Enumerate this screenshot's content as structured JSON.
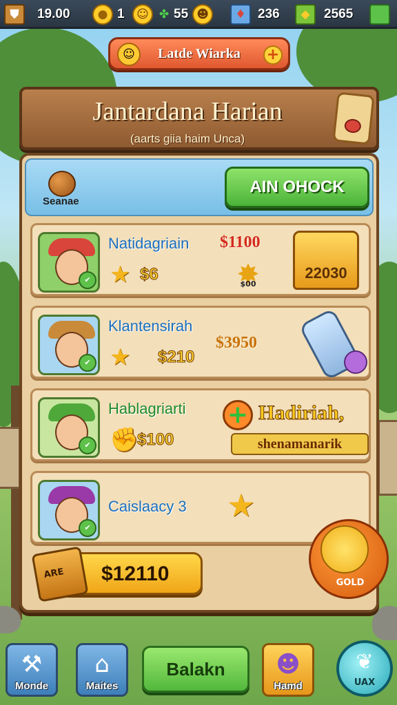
{
  "topbar": {
    "items": [
      {
        "icon": "shield-icon",
        "value": "19.00"
      },
      {
        "icon": "gold-coin-icon",
        "value": "1"
      },
      {
        "icon": "clover-icon",
        "value": "55"
      },
      {
        "icon": "gift-box-icon",
        "value": "236"
      },
      {
        "icon": "gem-icon",
        "value": "2565"
      }
    ],
    "add_icon": "plus-square-icon"
  },
  "event_banner": {
    "title": "Latde Wiarka",
    "icon": "smiley-face-icon"
  },
  "header": {
    "title": "Jantardana Harian",
    "subtitle": "(aarts giia haim Unca)"
  },
  "panel_head": {
    "season_label": "Seanae",
    "unlock_label": "AIN OHOCK"
  },
  "rows": [
    {
      "name": "Natidagriain",
      "price": "$1100",
      "mini_value": "$6",
      "burst_label": "$00",
      "reward_value": "22030"
    },
    {
      "name": "Klantensirah",
      "price": "$3950",
      "mini_value": "$210"
    },
    {
      "name": "Hablagriarti",
      "mini_value": "$100",
      "special_title": "Hadiriah,",
      "special_subtitle": "shenamanarik"
    },
    {
      "name": "Caislaacy 3",
      "chest_label": "ARE",
      "chest_value": "$12110",
      "orb_value": "GOLD"
    }
  ],
  "colors": {
    "row_name_blue": "#1b6fbe",
    "row_name_green": "#1f8a2a",
    "price_red": "#d42a1f",
    "price_orange": "#c8720a"
  },
  "bottom_nav": {
    "tiles": [
      {
        "label": "Monde",
        "icon": "hammer-icon"
      },
      {
        "label": "Maites",
        "icon": "house-icon"
      },
      {
        "label": "Hamd",
        "icon": "character-icon"
      }
    ],
    "back_label": "Balakn",
    "chat_label": "UAX"
  }
}
